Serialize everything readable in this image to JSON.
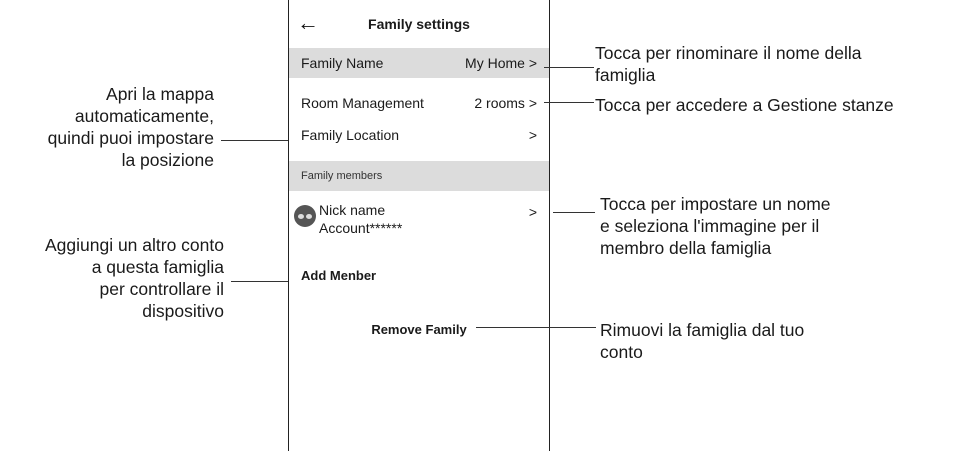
{
  "header": {
    "back_icon": "←",
    "title": "Family settings"
  },
  "rows": {
    "family_name": {
      "label": "Family Name",
      "value": "My Home >"
    },
    "room_management": {
      "label": "Room Management",
      "value": "2 rooms >"
    },
    "family_location": {
      "label": "Family Location",
      "value": ">"
    }
  },
  "members_section": {
    "title": "Family members",
    "member": {
      "name": "Nick name",
      "account": "Account******",
      "chevron": ">"
    }
  },
  "actions": {
    "add_member": "Add Menber",
    "remove_family": "Remove Family"
  },
  "annotations": {
    "rename": [
      "Tocca per rinominare il nome della",
      "famiglia"
    ],
    "rooms": [
      "Tocca per accedere a Gestione stanze"
    ],
    "location": [
      "Apri la mappa",
      "automaticamente,",
      "quindi puoi impostare",
      "la posizione"
    ],
    "member": [
      "Tocca per impostare un nome",
      "e seleziona l'immagine per il",
      "membro della famiglia"
    ],
    "add": [
      "Aggiungi un altro conto",
      "a questa famiglia",
      "per controllare il",
      "dispositivo"
    ],
    "remove": [
      "Rimuovi la famiglia dal tuo",
      "conto"
    ]
  }
}
